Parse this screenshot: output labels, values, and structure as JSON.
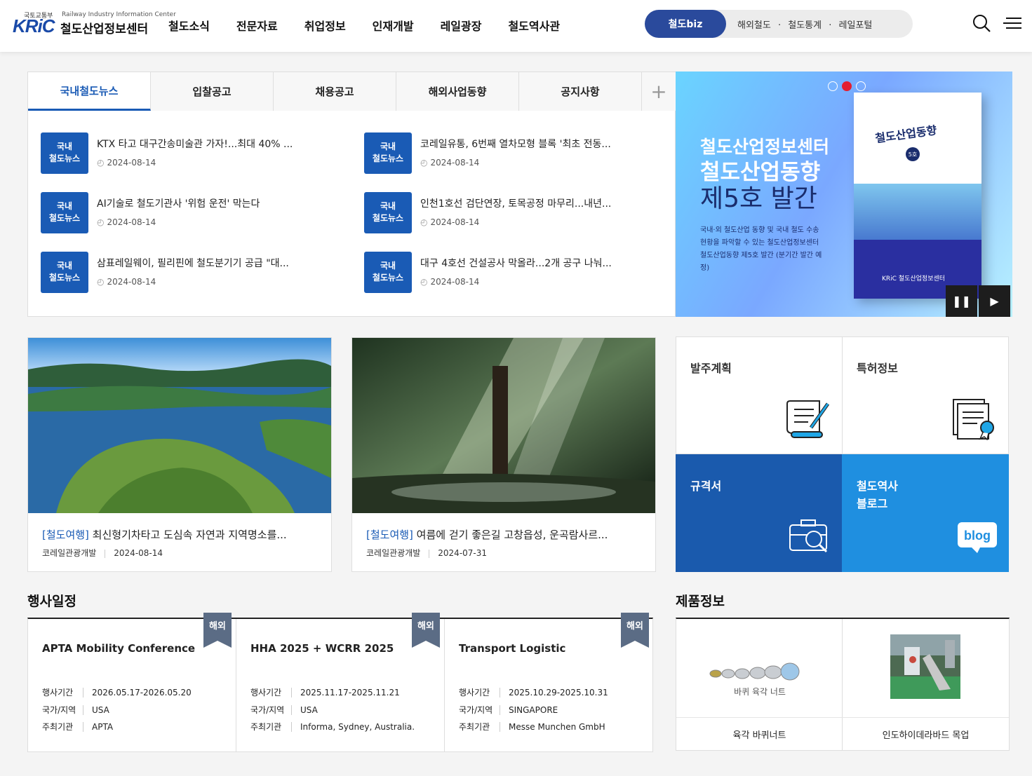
{
  "header": {
    "logo_ministry": "국토교통부",
    "logo_mark": "KRiC",
    "logo_en": "Railway Industry Information Center",
    "logo_ko": "철도산업정보센터",
    "nav": [
      "철도소식",
      "전문자료",
      "취업정보",
      "인재개발",
      "레일광장",
      "철도역사관"
    ],
    "quick_primary": "철도biz",
    "quick_links": [
      "해외철도",
      "·",
      "철도통계",
      "·",
      "레일포털"
    ],
    "search_icon": "search-icon",
    "menu_icon": "hamburger-menu-icon"
  },
  "news": {
    "tabs": [
      "국내철도뉴스",
      "입찰공고",
      "채용공고",
      "해외사업동향",
      "공지사항"
    ],
    "active_tab": 0,
    "badge_line1": "국내",
    "badge_line2": "철도뉴스",
    "items": [
      {
        "title": "KTX 타고 대구간송미술관 가자!...최대 40% ...",
        "date": "2024-08-14"
      },
      {
        "title": "코레일유통, 6번째 열차모형 블록 '최초 전동...",
        "date": "2024-08-14"
      },
      {
        "title": "AI기술로 철도기관사 '위험 운전' 막는다",
        "date": "2024-08-14"
      },
      {
        "title": "인천1호선 검단연장, 토목공정 마무리...내년...",
        "date": "2024-08-14"
      },
      {
        "title": "삼표레일웨이, 필리핀에 철도분기기 공급 \"대...",
        "date": "2024-08-14"
      },
      {
        "title": "대구 4호선 건설공사 막올라...2개 공구 나눠...",
        "date": "2024-08-14"
      }
    ]
  },
  "banner": {
    "line1": "철도산업정보센터",
    "line2": "철도산업동향",
    "line3": "제5호 발간",
    "desc": "국내·외 철도산업 동향 및 국내 철도 수송 현황을 파악할 수 있는 철도산업정보센터 철도산업동향 제5호 발간 (분기간 발간 예정)",
    "book_title": "철도산업동향",
    "book_issue": "5호",
    "book_logo": "KRiC 철도산업정보센터",
    "pause_icon": "pause-icon",
    "next_icon": "play-icon",
    "active_dot": 1
  },
  "travel": [
    {
      "tag": "[철도여행]",
      "title": " 최신형기차타고 도심속 자연과 지역명소를...",
      "source": "코레일관광개발",
      "date": "2024-08-14"
    },
    {
      "tag": "[철도여행]",
      "title": " 여름에 걷기 좋은길 고창읍성, 운곡람사르...",
      "source": "코레일관광개발",
      "date": "2024-07-31"
    }
  ],
  "quick_menu": [
    {
      "label": "발주계획",
      "icon": "order-plan-icon"
    },
    {
      "label": "특허정보",
      "icon": "patent-certificate-icon"
    },
    {
      "label": "규격서",
      "icon": "spec-toolbox-icon"
    },
    {
      "label": "철도역사\n블로그",
      "icon": "blog-bubble-icon",
      "icon_text": "blog"
    }
  ],
  "events": {
    "title": "행사일정",
    "flag": "해외",
    "keys": [
      "행사기간",
      "국가/지역",
      "주최기관"
    ],
    "items": [
      {
        "title": "APTA Mobility Conference",
        "period": "2026.05.17-2026.05.20",
        "country": "USA",
        "host": "APTA"
      },
      {
        "title": "HHA 2025 + WCRR 2025",
        "period": "2025.11.17-2025.11.21",
        "country": "USA",
        "host": "Informa, Sydney, Australia."
      },
      {
        "title": "Transport Logistic",
        "period": "2025.10.29-2025.10.31",
        "country": "SINGAPORE",
        "host": "Messe Munchen GmbH"
      }
    ]
  },
  "products": {
    "title": "제품정보",
    "items": [
      {
        "name": "육각 바퀴너트",
        "img_caption": "바퀴 육각 너트"
      },
      {
        "name": "인도하이데라바드 목업",
        "img_caption": ""
      }
    ]
  },
  "colors": {
    "primary": "#1a5bb5",
    "navy": "#2a4a9c",
    "sky": "#1f8fe0",
    "red_dot": "#e41e2f"
  }
}
